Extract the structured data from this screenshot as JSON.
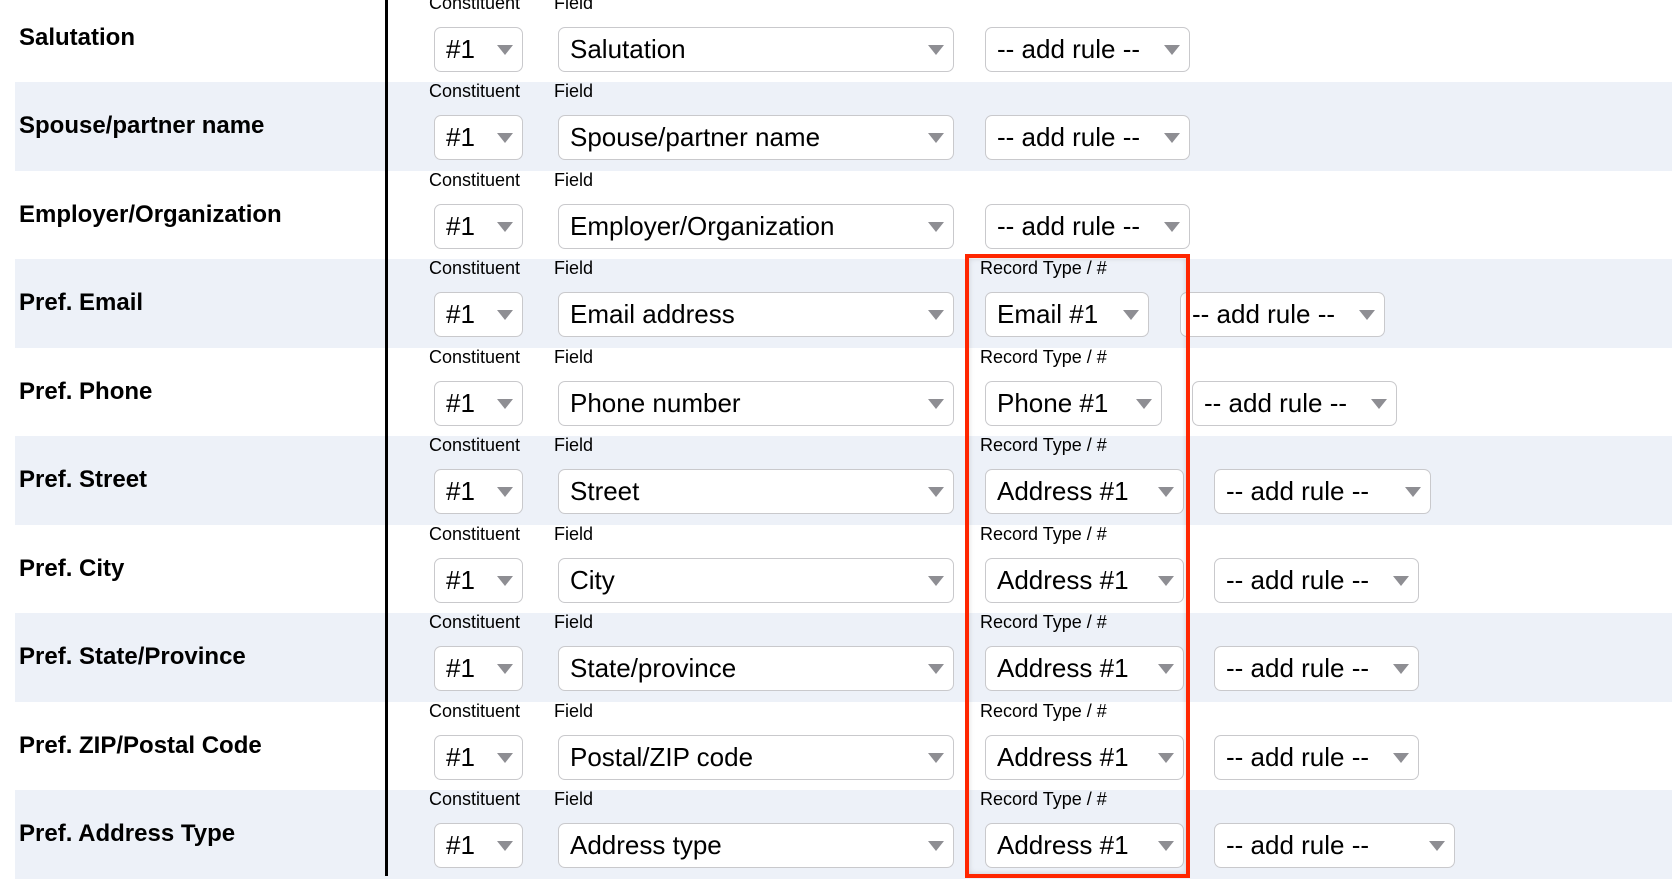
{
  "labels": {
    "constituent": "Constituent",
    "field": "Field",
    "record_type": "Record Type / #"
  },
  "rows": [
    {
      "name": "Salutation",
      "constituent": "#1",
      "field": "Salutation",
      "record_type": null,
      "rule": "-- add rule --"
    },
    {
      "name": "Spouse/partner name",
      "constituent": "#1",
      "field": "Spouse/partner name",
      "record_type": null,
      "rule": "-- add rule --"
    },
    {
      "name": "Employer/Organization",
      "constituent": "#1",
      "field": "Employer/Organization",
      "record_type": null,
      "rule": "-- add rule --"
    },
    {
      "name": "Pref. Email",
      "constituent": "#1",
      "field": "Email address",
      "record_type": "Email #1",
      "rule": "-- add rule --"
    },
    {
      "name": "Pref. Phone",
      "constituent": "#1",
      "field": "Phone number",
      "record_type": "Phone #1",
      "rule": "-- add rule --"
    },
    {
      "name": "Pref. Street",
      "constituent": "#1",
      "field": "Street",
      "record_type": "Address #1",
      "rule": "-- add rule --"
    },
    {
      "name": "Pref. City",
      "constituent": "#1",
      "field": "City",
      "record_type": "Address #1",
      "rule": "-- add rule --"
    },
    {
      "name": "Pref. State/Province",
      "constituent": "#1",
      "field": "State/province",
      "record_type": "Address #1",
      "rule": "-- add rule --"
    },
    {
      "name": "Pref. ZIP/Postal Code",
      "constituent": "#1",
      "field": "Postal/ZIP code",
      "record_type": "Address #1",
      "rule": "-- add rule --"
    },
    {
      "name": "Pref. Address Type",
      "constituent": "#1",
      "field": "Address type",
      "record_type": "Address #1",
      "rule": "-- add rule --"
    }
  ],
  "colors": {
    "highlight": "#ff2600",
    "band": "#edf1f8"
  }
}
